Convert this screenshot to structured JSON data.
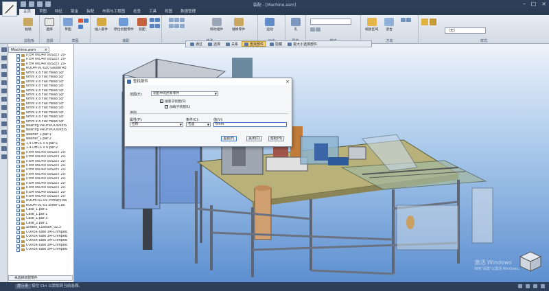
{
  "window": {
    "title": "装配 - [Machine.asm]",
    "controls": [
      "–",
      "□",
      "×"
    ]
  },
  "ribbon_tabs": [
    {
      "label": "主页",
      "active": true
    },
    {
      "label": "草图",
      "active": false
    },
    {
      "label": "特征",
      "active": false
    },
    {
      "label": "钣金",
      "active": false
    },
    {
      "label": "装配",
      "active": false
    },
    {
      "label": "布局与工程图",
      "active": false
    },
    {
      "label": "检查",
      "active": false
    },
    {
      "label": "工具",
      "active": false
    },
    {
      "label": "视图",
      "active": false
    },
    {
      "label": "数据管理",
      "active": false
    }
  ],
  "ribbon_groups": [
    {
      "label": "剪贴板"
    },
    {
      "label": "选择"
    },
    {
      "label": "草图"
    },
    {
      "label": "装配"
    },
    {
      "label": "修改"
    },
    {
      "label": "运动"
    },
    {
      "label": "导航"
    },
    {
      "label": "样式"
    },
    {
      "label": "方向"
    },
    {
      "label": "样式"
    }
  ],
  "ribbon_buttons": {
    "paste": "粘贴",
    "select": "选择",
    "sketch": "草图",
    "insert_part": "插入部件",
    "create_in_place": "原位创建零件",
    "assemble": "装配",
    "drag_component": "拖动组件",
    "replace_part": "替换零件",
    "motion": "运动",
    "hole": "孔",
    "zoom_area": "缩放区域",
    "fit": "适合",
    "style_value": "（无）"
  },
  "view_toolbar": {
    "items": [
      {
        "label": "通过",
        "active": false
      },
      {
        "label": "选择",
        "active": false
      },
      {
        "label": "关系",
        "active": false
      },
      {
        "label": "查找部件",
        "active": true
      },
      {
        "label": "隐藏",
        "active": false
      },
      {
        "label": "拔大小选择部件",
        "active": false
      }
    ]
  },
  "left_panel": {
    "doc_tab": "Machine.asm",
    "filter_placeholder": "未选择装配零件",
    "tree": [
      "ITEM 00D40 00SZET 20-",
      "ITEM 00D40 00SZET 20-",
      "ITEM 00D40 00SZET 20-",
      "ROOM-01-020 Gaude Ro",
      "6mm x 8 Flat Head Scr",
      "6mm x 8 Flat Head Scr",
      "6mm x 8 Flat Head Scr",
      "6mm x 8 Flat Head Scr",
      "6mm x 8 Flat Head Scr",
      "6mm x 8 Flat Head Scr",
      "6mm x 8 Flat Head Scr",
      "6mm x 8 Flat Head Scr",
      "6mm x 8 Flat Head Scr",
      "6mm x 8 Flat Head Scr",
      "6mm x 8 Flat Head Scr",
      "6mm x 8 Flat Head Scr",
      "Bearing PROFIPOOOKEIS",
      "Bearing PROFIPOOOKEIS",
      "washer_1.par:1",
      "washer_1.par:2",
      "1.4 DHCS X 6.par:1",
      "1.4 DHCS X 6.par:2",
      "ITEM 00D40 00SZET 20-",
      "ITEM 00D40 00SZET 20-",
      "ITEM 00D40 00SZET 20-",
      "ITEM 00D40 00SZET 20-",
      "ITEM 00D40 00SZET 20-",
      "ITEM 00D40 00SZET 20-",
      "ITEM 00D40 00SZET 20-",
      "ITEM 00D40 00SZET 20-",
      "ITEM 00D40 00SZET 20-",
      "ITEM 00D40 00SZET 20-",
      "ITEM 00D40 00SZET 20-",
      "ROOm-01-09 Primary Ba",
      "ROOM-01-01 Slider Cas",
      "Case_1.par:1",
      "Case_1.par:1",
      "Case_1.par:3",
      "Case_2.par:1",
      "Sliders_Cushion_02.3",
      "COVER-Tube 3M-Crimped",
      "COVER-Tube 3M-Crimped",
      "COVER-Tube 3M-Crimped",
      "COVER-Tube 3M-Crimped",
      "COVER-Tube 3M-Crimped"
    ]
  },
  "dialog": {
    "title": "查找部件",
    "scope_label": "范围(E):",
    "scope_value": "装配中的所有零件",
    "check_search_sub": "搜索子装配(S)",
    "check_load_sub": "加载子装配(L)",
    "criteria_label": "准则",
    "attribute_label": "属性(P):",
    "attribute_value": "名称",
    "condition_label": "条件(C):",
    "condition_value": "包含",
    "value_label": "值(V):",
    "value_input": "6mm",
    "find_button": "查找(F)",
    "close_button": "关闭(C)",
    "help_button": "帮助(H)"
  },
  "viewport": {
    "watermark_title": "激活 Windows",
    "watermark_sub": "转到\"设置\"以激活 Windows。",
    "viewcube_label": "TOP"
  },
  "status_bar": {
    "prompt_label": "提示条",
    "message": "按住 Ctrl 以添加到当前选择。"
  }
}
